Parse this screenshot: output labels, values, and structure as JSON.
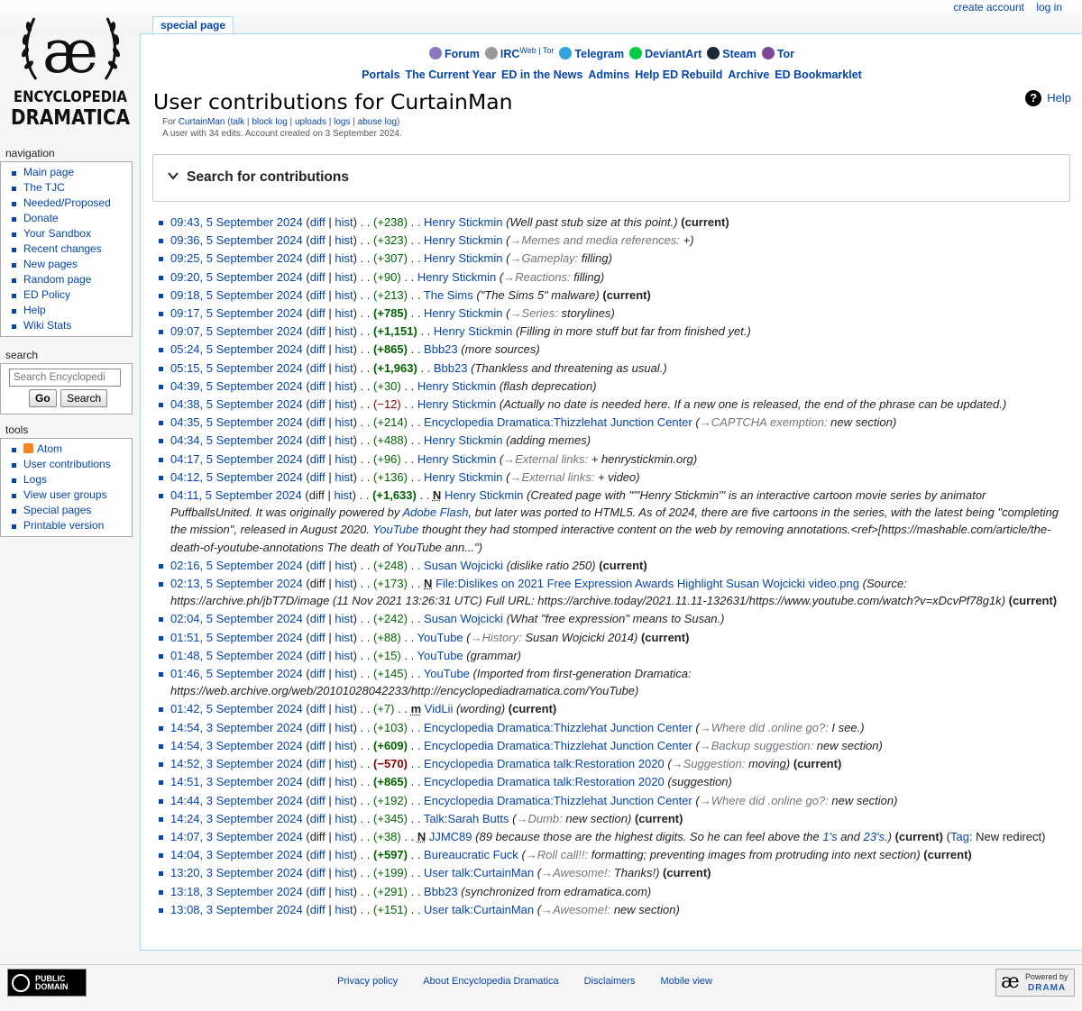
{
  "personal": {
    "create_account": "create account",
    "log_in": "log in"
  },
  "logo": {
    "ae": "æ",
    "line1": "ENCYCLOPEDIA",
    "line2": "DRAMATICA"
  },
  "tab": {
    "label": "special page"
  },
  "sitenotice": {
    "row1": [
      {
        "label": "Forum",
        "icon": "forum-icon",
        "color": "#8a78c0"
      },
      {
        "label": "IRC",
        "icon": "irc-icon",
        "color": "#999999",
        "sup1": "Web",
        "sup2": "Tor"
      },
      {
        "label": "Telegram",
        "icon": "telegram-icon",
        "color": "#2ea3de"
      },
      {
        "label": "DeviantArt",
        "icon": "deviantart-icon",
        "color": "#05cc47"
      },
      {
        "label": "Steam",
        "icon": "steam-icon",
        "color": "#1b2838"
      },
      {
        "label": "Tor",
        "icon": "tor-icon",
        "color": "#7d4698"
      }
    ],
    "row2": [
      "Portals",
      "The Current Year",
      "ED in the News",
      "Admins",
      "Help ED Rebuild",
      "Archive",
      "ED Bookmarklet"
    ]
  },
  "page": {
    "title": "User contributions for CurtainMan",
    "help": "Help",
    "sub": {
      "for": "For",
      "user": "CurtainMan",
      "talk": "talk",
      "block_log": "block log",
      "uploads": "uploads",
      "logs": "logs",
      "abuse_log": "abuse log",
      "summary": "A user with 34 edits. Account created on 3 September 2024."
    },
    "search_heading": "Search for contributions"
  },
  "contribs": [
    {
      "ts": "09:43, 5 September 2024",
      "diff": true,
      "delta": "+238",
      "cls": "pos",
      "page": "Henry Stickmin",
      "comment": "Well past stub size at this point.",
      "current": true
    },
    {
      "ts": "09:36, 5 September 2024",
      "diff": true,
      "delta": "+323",
      "cls": "pos",
      "page": "Henry Stickmin",
      "sec": "→Memes and media references:",
      "comment": " +"
    },
    {
      "ts": "09:25, 5 September 2024",
      "diff": true,
      "delta": "+307",
      "cls": "pos",
      "page": "Henry Stickmin",
      "sec": "→Gameplay:",
      "comment": " filling"
    },
    {
      "ts": "09:20, 5 September 2024",
      "diff": true,
      "delta": "+90",
      "cls": "pos",
      "page": "Henry Stickmin",
      "sec": "→Reactions:",
      "comment": " filling"
    },
    {
      "ts": "09:18, 5 September 2024",
      "diff": true,
      "delta": "+213",
      "cls": "pos",
      "page": "The Sims",
      "comment": "\"The Sims 5\" malware",
      "current": true
    },
    {
      "ts": "09:17, 5 September 2024",
      "diff": true,
      "delta": "+785",
      "cls": "pos big",
      "page": "Henry Stickmin",
      "sec": "→Series:",
      "comment": " storylines"
    },
    {
      "ts": "09:07, 5 September 2024",
      "diff": true,
      "delta": "+1,151",
      "cls": "pos big",
      "page": "Henry Stickmin",
      "comment": "Filling in more stuff but far from finished yet."
    },
    {
      "ts": "05:24, 5 September 2024",
      "diff": true,
      "delta": "+865",
      "cls": "pos big",
      "page": "Bbb23",
      "comment": "more sources"
    },
    {
      "ts": "05:15, 5 September 2024",
      "diff": true,
      "delta": "+1,963",
      "cls": "pos big",
      "page": "Bbb23",
      "comment": "Thankless and threatening as usual."
    },
    {
      "ts": "04:39, 5 September 2024",
      "diff": true,
      "delta": "+30",
      "cls": "pos",
      "page": "Henry Stickmin",
      "comment": "flash deprecation"
    },
    {
      "ts": "04:38, 5 September 2024",
      "diff": true,
      "delta": "−12",
      "cls": "neg",
      "page": "Henry Stickmin",
      "comment": "Actually no date is needed here. If a new one is released, the end of the phrase can be updated."
    },
    {
      "ts": "04:35, 5 September 2024",
      "diff": true,
      "delta": "+214",
      "cls": "pos",
      "page": "Encyclopedia Dramatica:Thizzlehat Junction Center",
      "sec": "→CAPTCHA exemption:",
      "comment": " new section"
    },
    {
      "ts": "04:34, 5 September 2024",
      "diff": true,
      "delta": "+488",
      "cls": "pos",
      "page": "Henry Stickmin",
      "comment": "adding memes"
    },
    {
      "ts": "04:17, 5 September 2024",
      "diff": true,
      "delta": "+96",
      "cls": "pos",
      "page": "Henry Stickmin",
      "sec": "→External links:",
      "comment": " + henrystickmin.org"
    },
    {
      "ts": "04:12, 5 September 2024",
      "diff": true,
      "delta": "+136",
      "cls": "pos",
      "page": "Henry Stickmin",
      "sec": "→External links:",
      "comment": " + video"
    },
    {
      "ts": "04:11, 5 September 2024",
      "diff": false,
      "delta": "+1,633",
      "cls": "pos big",
      "flag": "N",
      "page": "Henry Stickmin",
      "comment_parts": [
        "Created page with \"'''Henry Stickmin''' is an interactive cartoon movie series by animator PuffballsUnited. It was originally powered by ",
        {
          "link": "Adobe Flash"
        },
        ", but later was ported to HTML5. As of 2024, there are five cartoons in the series, with the latest being \"completing the mission\", released in August 2020. ",
        {
          "link": "YouTube"
        },
        " thought they had stomped interactive content on the web by removing annotations.<ref>[https://mashable.com/article/the-death-of-youtube-annotations The death of YouTube ann...\""
      ]
    },
    {
      "ts": "02:16, 5 September 2024",
      "diff": true,
      "delta": "+248",
      "cls": "pos",
      "page": "Susan Wojcicki",
      "comment": "dislike ratio 250",
      "current": true
    },
    {
      "ts": "02:13, 5 September 2024",
      "diff": false,
      "delta": "+173",
      "cls": "pos",
      "flag": "N",
      "page": "File:Dislikes on 2021 Free Expression Awards Highlight Susan Wojcicki video.png",
      "comment": "Source: https://archive.ph/jbT7D/image (11 Nov 2021 13:26:31 UTC) Full URL: https://archive.today/2021.11.11-132631/https://www.youtube.com/watch?v=xDcvPf78g1k",
      "current": true
    },
    {
      "ts": "02:04, 5 September 2024",
      "diff": true,
      "delta": "+242",
      "cls": "pos",
      "page": "Susan Wojcicki",
      "comment": "What \"free expression\" means to Susan."
    },
    {
      "ts": "01:51, 5 September 2024",
      "diff": true,
      "delta": "+88",
      "cls": "pos",
      "page": "YouTube",
      "sec": "→History:",
      "comment": " Susan Wojcicki 2014",
      "current": true
    },
    {
      "ts": "01:48, 5 September 2024",
      "diff": true,
      "delta": "+15",
      "cls": "pos",
      "page": "YouTube",
      "comment": "grammar"
    },
    {
      "ts": "01:46, 5 September 2024",
      "diff": true,
      "delta": "+145",
      "cls": "pos",
      "page": "YouTube",
      "comment": "Imported from first-generation Dramatica: https://web.archive.org/web/20101028042233/http://encyclopediadramatica.com/YouTube"
    },
    {
      "ts": "01:42, 5 September 2024",
      "diff": true,
      "delta": "+7",
      "cls": "pos",
      "flag": "m",
      "page": "VidLii",
      "comment": "wording",
      "current": true
    },
    {
      "ts": "14:54, 3 September 2024",
      "diff": true,
      "delta": "+103",
      "cls": "pos",
      "page": "Encyclopedia Dramatica:Thizzlehat Junction Center",
      "sec": "→Where did .online go?:",
      "comment": " I see."
    },
    {
      "ts": "14:54, 3 September 2024",
      "diff": true,
      "delta": "+609",
      "cls": "pos big",
      "page": "Encyclopedia Dramatica:Thizzlehat Junction Center",
      "sec": "→Backup suggestion:",
      "comment": " new section"
    },
    {
      "ts": "14:52, 3 September 2024",
      "diff": true,
      "delta": "−570",
      "cls": "neg big",
      "page": "Encyclopedia Dramatica talk:Restoration 2020",
      "sec": "→Suggestion:",
      "comment": " moving",
      "current": true
    },
    {
      "ts": "14:51, 3 September 2024",
      "diff": true,
      "delta": "+865",
      "cls": "pos big",
      "page": "Encyclopedia Dramatica talk:Restoration 2020",
      "comment": "suggestion"
    },
    {
      "ts": "14:44, 3 September 2024",
      "diff": true,
      "delta": "+192",
      "cls": "pos",
      "page": "Encyclopedia Dramatica:Thizzlehat Junction Center",
      "sec": "→Where did .online go?:",
      "comment": " new section"
    },
    {
      "ts": "14:24, 3 September 2024",
      "diff": true,
      "delta": "+345",
      "cls": "pos",
      "page": "Talk:Sarah Butts",
      "sec": "→Dumb:",
      "comment": " new section",
      "current": true
    },
    {
      "ts": "14:07, 3 September 2024",
      "diff": false,
      "delta": "+38",
      "cls": "pos",
      "flag": "N",
      "page": "JJMC89",
      "comment_parts": [
        "89 because those are the highest digits. So he can feel above the ",
        {
          "link": "1's"
        },
        " and ",
        {
          "link": "23's"
        },
        "."
      ],
      "current": true,
      "tag": "New redirect"
    },
    {
      "ts": "14:04, 3 September 2024",
      "diff": true,
      "delta": "+597",
      "cls": "pos big",
      "page": "Bureaucratic Fuck",
      "sec": "→Roll call!!:",
      "comment": " formatting; preventing images from protruding into next section",
      "current": true
    },
    {
      "ts": "13:20, 3 September 2024",
      "diff": true,
      "delta": "+199",
      "cls": "pos",
      "page": "User talk:CurtainMan",
      "sec": "→Awesome!:",
      "comment": " Thanks!",
      "current": true
    },
    {
      "ts": "13:18, 3 September 2024",
      "diff": true,
      "delta": "+291",
      "cls": "pos",
      "page": "Bbb23",
      "comment": "synchronized from edramatica.com"
    },
    {
      "ts": "13:08, 3 September 2024",
      "diff": true,
      "delta": "+151",
      "cls": "pos",
      "page": "User talk:CurtainMan",
      "sec": "→Awesome!:",
      "comment": " new section"
    }
  ],
  "labels": {
    "diff": "diff",
    "hist": "hist",
    "current": "current",
    "tag": "Tag"
  },
  "sidebar": {
    "navigation": {
      "heading": "navigation",
      "items": [
        "Main page",
        "The TJC",
        "Needed/Proposed",
        "Donate",
        "Your Sandbox",
        "Recent changes",
        "New pages",
        "Random page",
        "ED Policy",
        "Help",
        "Wiki Stats"
      ]
    },
    "search": {
      "heading": "search",
      "placeholder": "Search Encyclopedi",
      "go": "Go",
      "search": "Search"
    },
    "tools": {
      "heading": "tools",
      "items": [
        "Atom",
        "User contributions",
        "Logs",
        "View user groups",
        "Special pages",
        "Printable version"
      ]
    }
  },
  "footer": {
    "links": [
      "Privacy policy",
      "About Encyclopedia Dramatica",
      "Disclaimers",
      "Mobile view"
    ],
    "pd_line1": "PUBLIC",
    "pd_line2": "DOMAIN",
    "powered": "Powered by",
    "drama": "DRAMA",
    "ae": "æ"
  }
}
